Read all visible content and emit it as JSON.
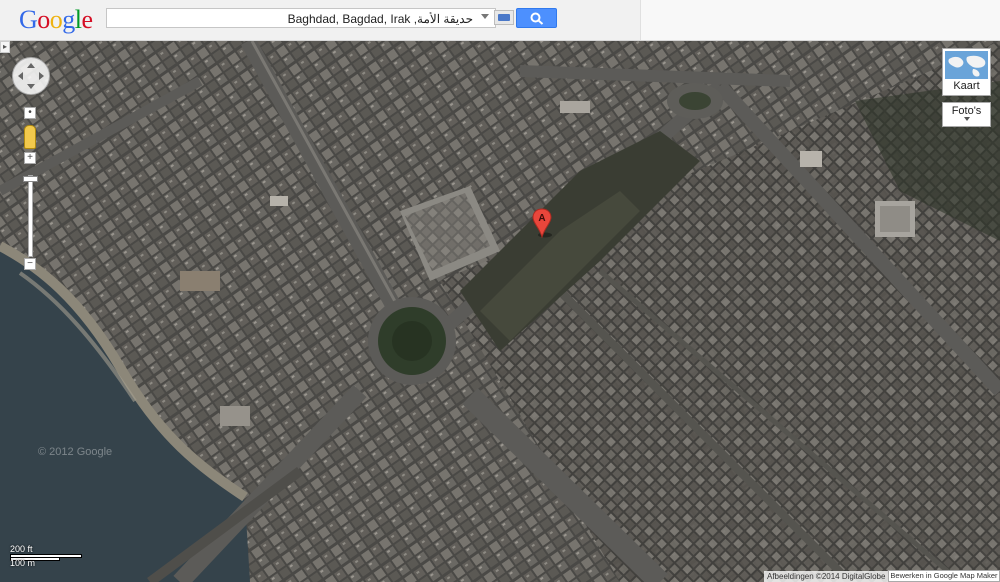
{
  "header": {
    "logo_letters": [
      {
        "char": "G",
        "color": "#3369e8"
      },
      {
        "char": "o",
        "color": "#d50f25"
      },
      {
        "char": "o",
        "color": "#eeb211"
      },
      {
        "char": "g",
        "color": "#3369e8"
      },
      {
        "char": "l",
        "color": "#009925"
      },
      {
        "char": "e",
        "color": "#d50f25"
      }
    ],
    "search": {
      "value": "حديقة الأمة, Baghdad, Bagdad, Irak",
      "keyboard_icon": "keyboard-icon",
      "button_icon": "search-icon"
    }
  },
  "map_controls": {
    "pan_icon": "pan-control-icon",
    "zoom_in": "+",
    "zoom_out": "−",
    "pegman_icon": "pegman-icon",
    "map_type_label": "Kaart",
    "photos_label": "Foto's",
    "marker_label": "A"
  },
  "map_footer": {
    "watermark": "© 2012 Google",
    "scale_imperial": "200 ft",
    "scale_metric": "100 m",
    "copyright": "Afbeeldingen ©2014 DigitalGlobe",
    "mapmaker_link": "Bewerken in Google Map Maker"
  },
  "colors": {
    "search_button": "#4d90fe",
    "marker": "#e8463b",
    "river": "#35434b"
  }
}
